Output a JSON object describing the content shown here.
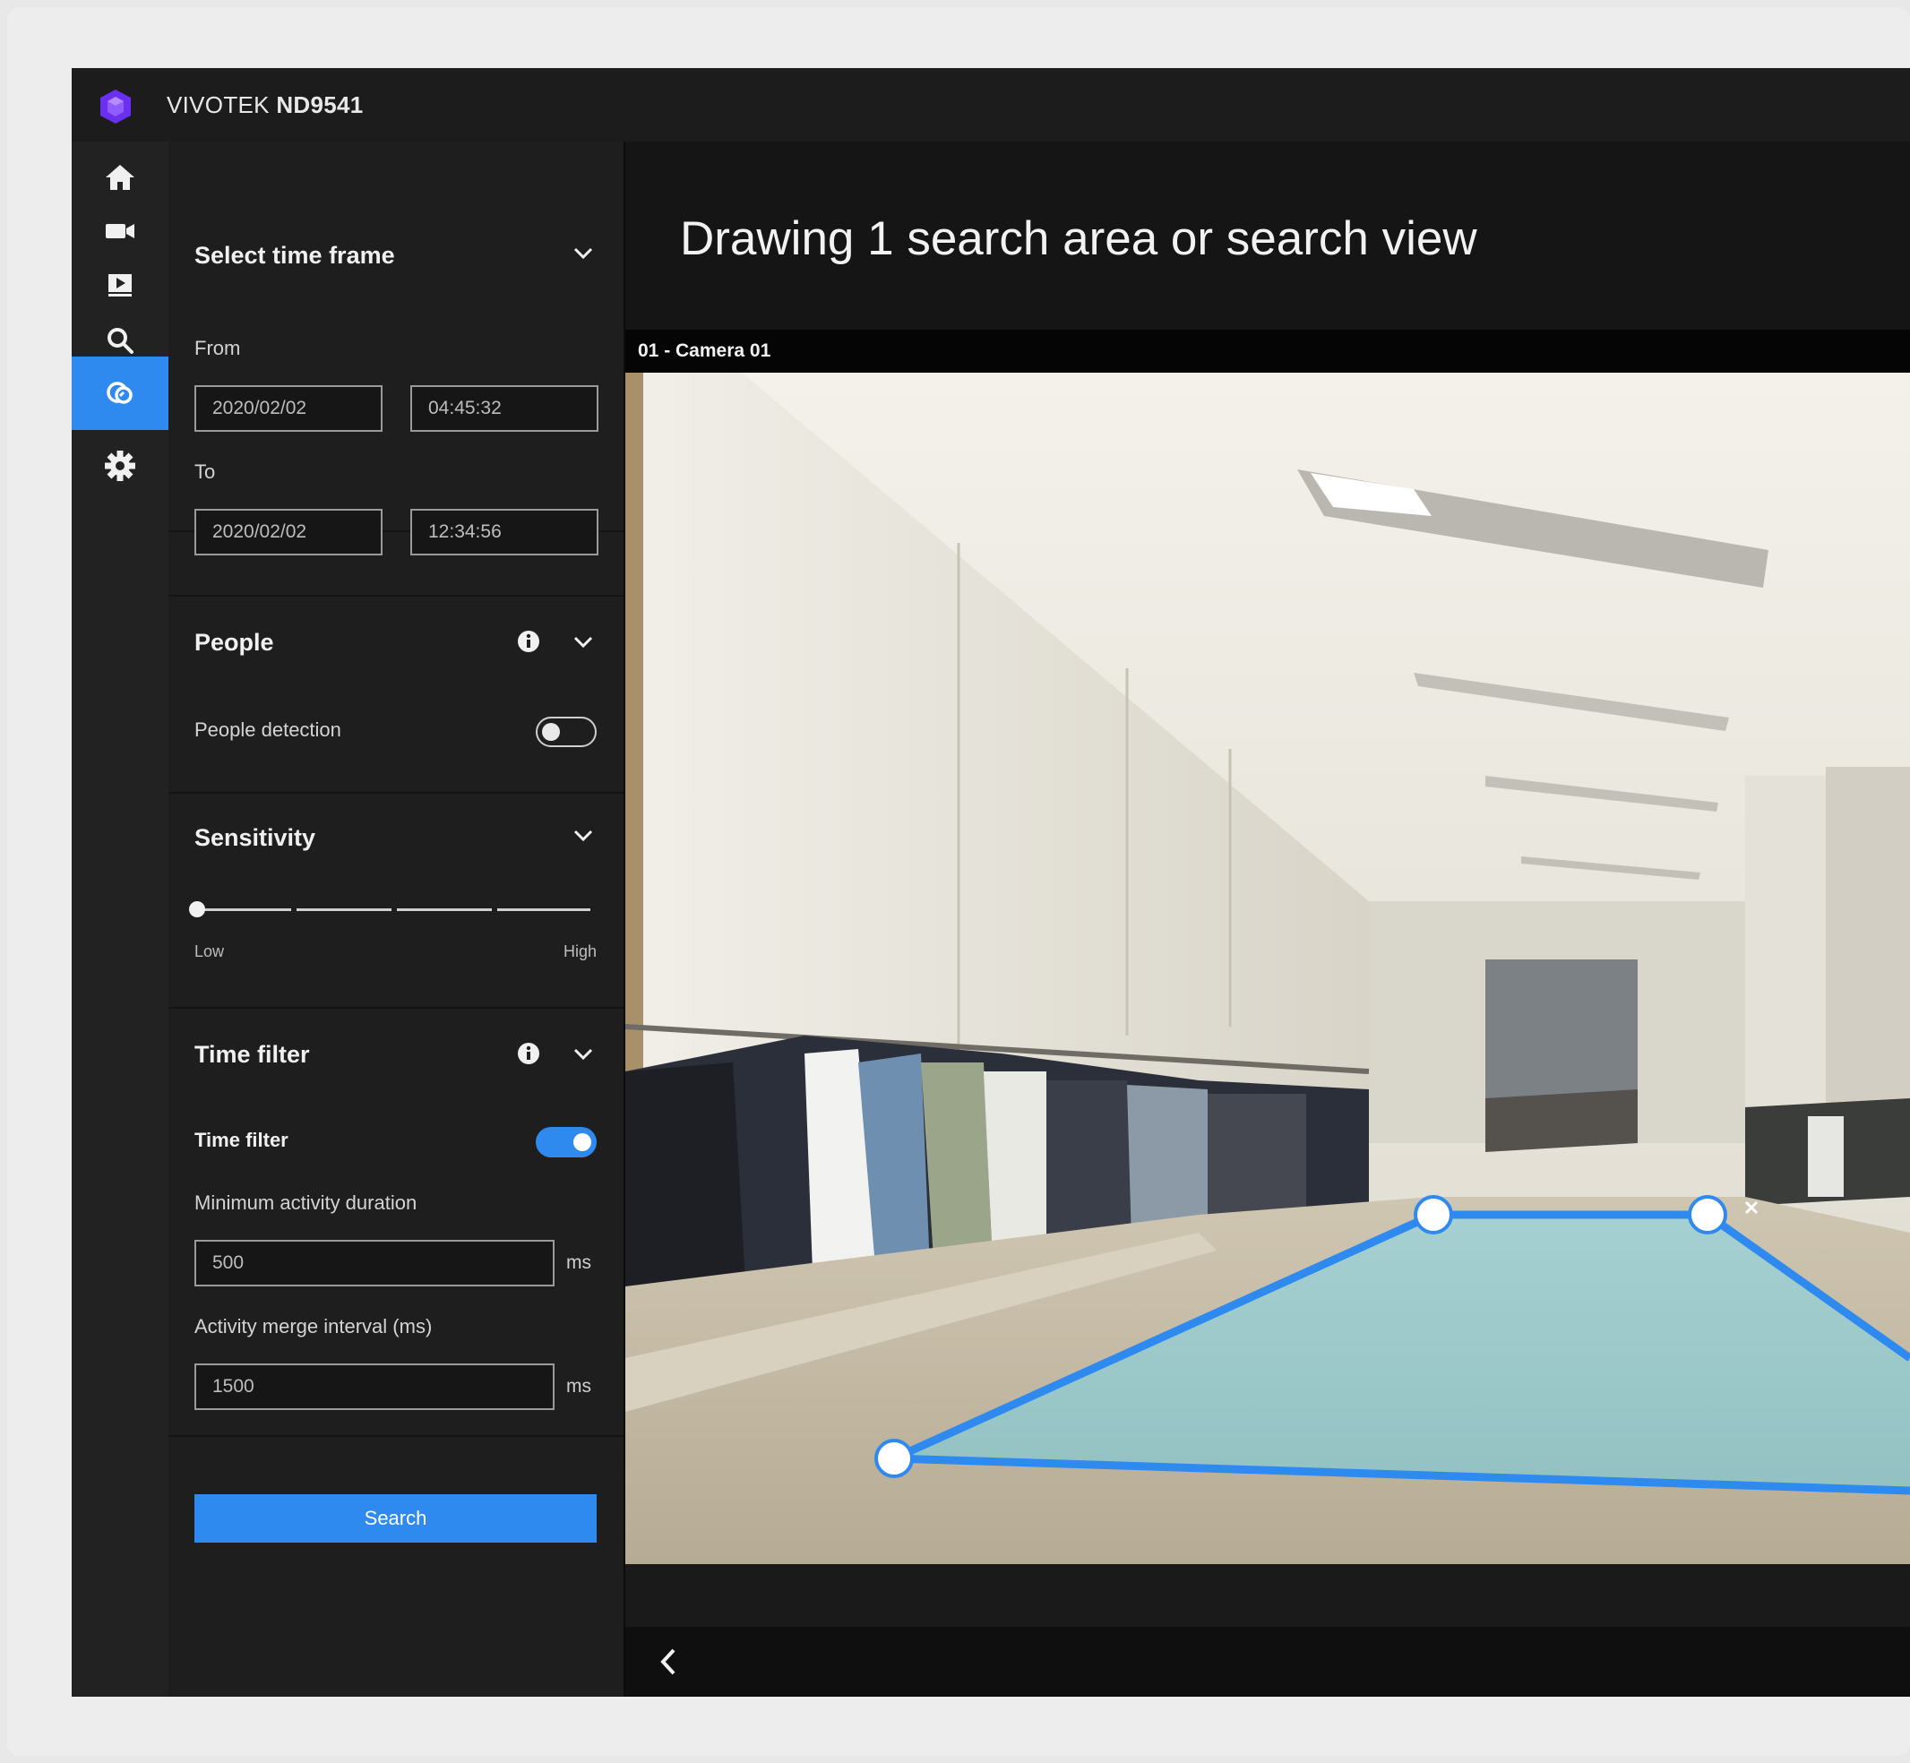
{
  "app": {
    "brand": "VIVOTEK",
    "model": "ND9541",
    "accent_color": "#2f8af0",
    "logo_color": "#6a2ff0"
  },
  "nav": {
    "items": [
      {
        "icon": "home-icon"
      },
      {
        "icon": "camera-icon"
      },
      {
        "icon": "playback-icon"
      },
      {
        "icon": "search-icon"
      },
      {
        "icon": "smart-search-icon",
        "active": true
      },
      {
        "icon": "settings-gear-icon"
      }
    ]
  },
  "time_frame": {
    "title": "Select time frame",
    "from_label": "From",
    "from_date": "2020/02/02",
    "from_time": "04:45:32",
    "to_label": "To",
    "to_date": "2020/02/02",
    "to_time": "12:34:56"
  },
  "people": {
    "title": "People",
    "detection_label": "People detection",
    "detection_on": false
  },
  "sensitivity": {
    "title": "Sensitivity",
    "low_label": "Low",
    "high_label": "High",
    "level": 0
  },
  "time_filter": {
    "title": "Time filter",
    "toggle_label": "Time filter",
    "enabled": true,
    "min_duration_label": "Minimum activity duration",
    "min_duration_value": "500",
    "min_duration_unit": "ms",
    "merge_label": "Activity merge interval (ms)",
    "merge_value": "1500",
    "merge_unit": "ms"
  },
  "search_button": "Search",
  "main": {
    "title": "Drawing 1 search area or search view",
    "camera_label": "01 - Camera 01"
  }
}
